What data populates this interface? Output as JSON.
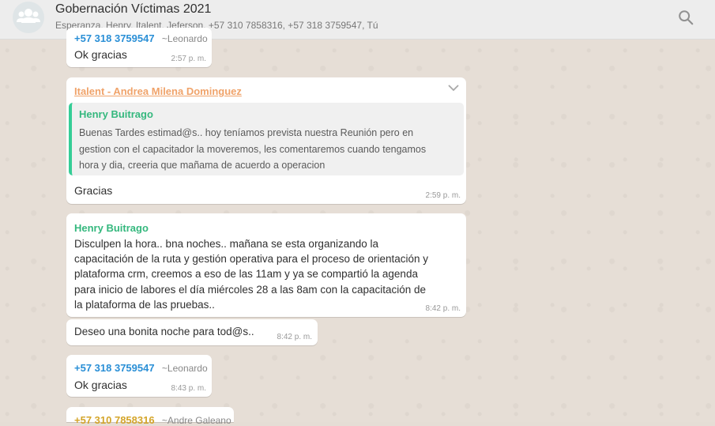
{
  "header": {
    "title": "Gobernación Víctimas 2021",
    "members": "Esperanza, Henry, Italent, Jeferson, +57 310 7858316, +57 318 3759547, Tú"
  },
  "messages": {
    "m1": {
      "author": "+57 318 3759547",
      "author_name": "~Leonardo",
      "text": "Ok gracias",
      "time": "2:57 p. m."
    },
    "m2": {
      "author": "Italent - Andrea Milena Dominguez",
      "quote_author": "Henry Buitrago",
      "quote_text": "Buenas Tardes estimad@s.. hoy teníamos prevista nuestra Reunión pero en gestion con el capacitador la moveremos, les comentaremos cuando tengamos hora y dia, creeria que mañama de acuerdo a operacion",
      "text": "Gracias",
      "time": "2:59 p. m."
    },
    "m3": {
      "author": "Henry Buitrago",
      "text": "Disculpen la hora.. bna noches.. mañana se esta organizando la capacitación de la ruta y gestión operativa para el proceso de orientación y plataforma crm, creemos a eso de las 11am y ya se compartió la agenda para inicio de labores el día miércoles 28 a las 8am con la capacitación de la plataforma de las pruebas..",
      "time": "8:42 p. m."
    },
    "m4": {
      "text": "Deseo una bonita noche para tod@s..",
      "time": "8:42 p. m."
    },
    "m5": {
      "author": "+57 318 3759547",
      "author_name": "~Leonardo",
      "text": "Ok gracias",
      "time": "8:43 p. m."
    },
    "m6": {
      "author": "+57 310 7858316",
      "author_name": "~Andre Galeano"
    }
  },
  "colors": {
    "wallpaper": "#e5ddd5",
    "bubble": "#ffffff",
    "author_blue": "#2a8fd6",
    "author_orange": "#f0a36a",
    "author_green": "#35b87e",
    "author_yellow": "#d4a52a"
  },
  "icons": {
    "avatar": "group-icon",
    "search": "search-icon",
    "menu": "chevron-down-icon"
  }
}
